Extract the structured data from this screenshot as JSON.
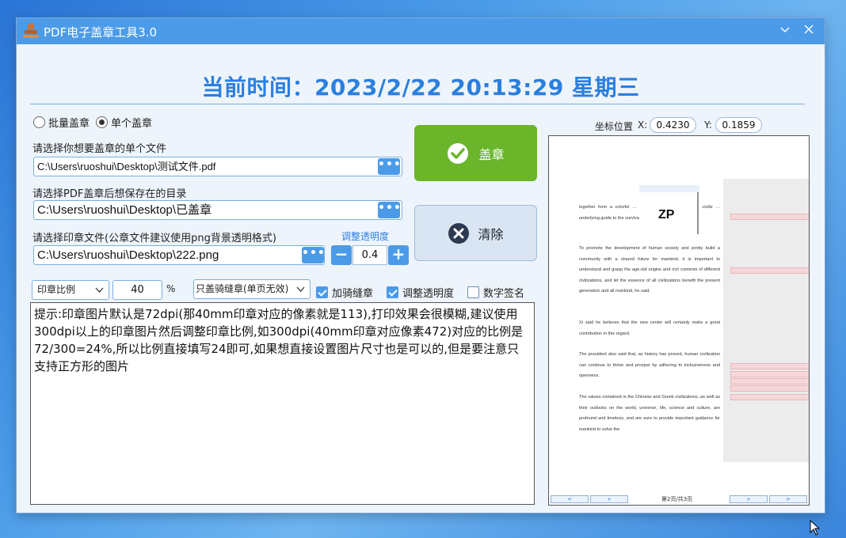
{
  "window": {
    "title": "PDF电子盖章工具3.0"
  },
  "header": {
    "current_time": "当前时间：2023/2/22 20:13:29  星期三"
  },
  "mode": {
    "batch_label": "批量盖章",
    "single_label": "单个盖章",
    "selected": "单个盖章"
  },
  "file_select": {
    "label": "请选择你想要盖章的单个文件",
    "value": "C:\\Users\\ruoshui\\Desktop\\测试文件.pdf",
    "browse": "•••"
  },
  "output_dir": {
    "label": "请选择PDF盖章后想保存在的目录",
    "value": "C:\\Users\\ruoshui\\Desktop\\已盖章",
    "browse": "•••"
  },
  "stamp_file": {
    "label": "请选择印章文件(公章文件建议使用png背景透明格式)",
    "value": "C:\\Users\\ruoshui\\Desktop\\222.png",
    "browse": "•••"
  },
  "opacity": {
    "label": "调整透明度",
    "value": "0.4",
    "minus": "−",
    "plus": "+"
  },
  "actions": {
    "stamp_label": "盖章",
    "clear_label": "清除"
  },
  "options": {
    "scale_select": "印章比例",
    "scale_value": "40",
    "percent": "%",
    "seam_select": "只盖骑缝章(单页无效)",
    "seam_check": {
      "label": "加骑缝章",
      "checked": true
    },
    "opacity_check": {
      "label": "调整透明度",
      "checked": true
    },
    "sign_check": {
      "label": "数字签名",
      "checked": false
    }
  },
  "tip": "提示:印章图片默认是72dpi(那40mm印章对应的像素就是113),打印效果会很模糊,建议使用300dpi以上的印章图片然后调整印章比例,如300dpi(40mm印章对应像素472)对应的比例是72/300=24%,所以比例直接填写24即可,如果想直接设置图片尺寸也是可以的,但是要注意只支持正方形的图片",
  "coords": {
    "label": "坐标位置",
    "x_label": "X:",
    "x": "0.4230",
    "y_label": "Y:",
    "y": "0.1859"
  },
  "preview": {
    "page_indicator": "第2页/共3页",
    "stamp_text": "ZP",
    "paragraphs": [
      "together form a colorful … nation. Xi said that different civiliz … underlying guide to the survival and …",
      "To promote the development of human society and jointly build a community with a shared future for mankind, it is important to understand and grasp the age-old origins and rich contents of different civilizations, and let the essence of all civilizations benefit the present generation and all mankind, he said.",
      "Xi said he believes that the new center will certainly make a great contribution in this regard.",
      "The president also said that, as history has proved, human civilization can continue to thrive and prosper by adhering to inclusiveness and openness.",
      "The values contained in the Chinese and Greek civilizations, as well as their outlooks on the world, universe, life, science and culture, are profound and timeless, and are sure to provide important guidance for mankind to solve the"
    ],
    "nav": {
      "first": "<",
      "prev": "«",
      "next": "»",
      "last": ">"
    }
  },
  "colors": {
    "accent": "#4b9be9",
    "title_blue": "#2a7fe0",
    "stamp_green": "#6ab52a"
  }
}
